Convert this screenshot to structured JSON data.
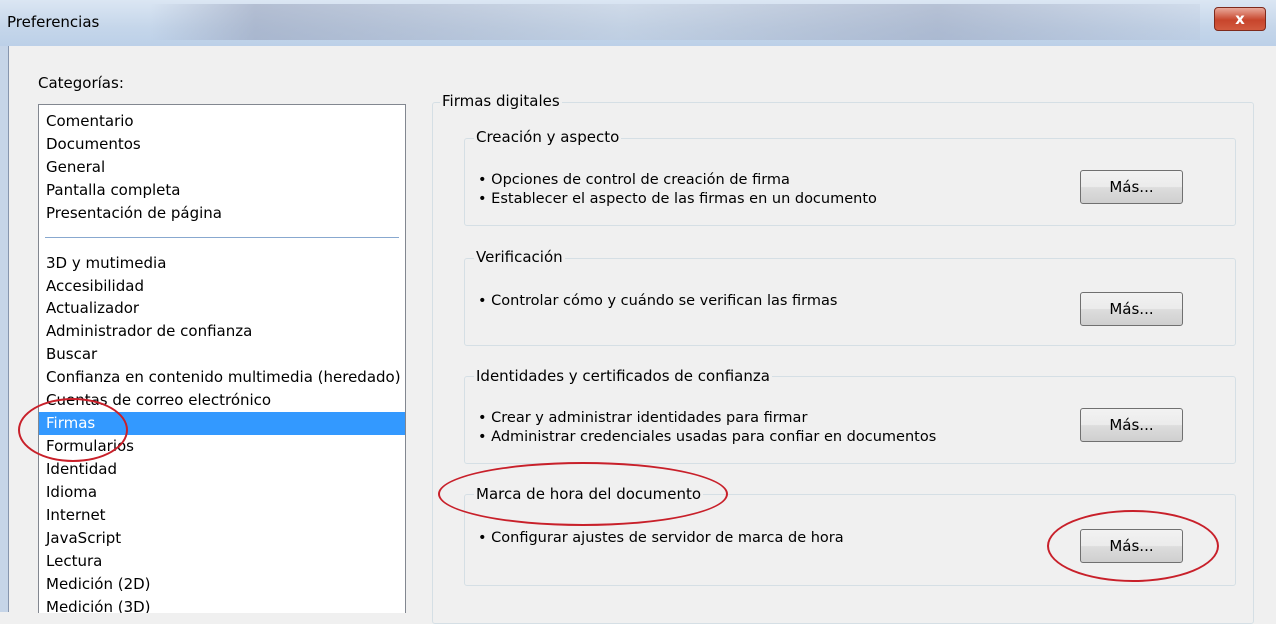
{
  "window": {
    "title": "Preferencias",
    "close_label": "x"
  },
  "categories_label": "Categorías:",
  "categories": {
    "group1": [
      "Comentario",
      "Documentos",
      "General",
      "Pantalla completa",
      "Presentación de página"
    ],
    "group2": [
      "3D y mutimedia",
      "Accesibilidad",
      "Actualizador",
      "Administrador de confianza",
      "Buscar",
      "Confianza en contenido multimedia (heredado)",
      "Cuentas de correo electrónico",
      "Firmas",
      "Formularios",
      "Identidad",
      "Idioma",
      "Internet",
      "JavaScript",
      "Lectura",
      "Medición (2D)",
      "Medición (3D)"
    ],
    "selected": "Firmas"
  },
  "panel": {
    "title": "Firmas digitales",
    "sections": [
      {
        "title": "Creación y aspecto",
        "lines": [
          "• Opciones de control de creación de firma",
          "• Establecer el aspecto de las firmas en un documento"
        ],
        "button": "Más..."
      },
      {
        "title": "Verificación",
        "lines": [
          "• Controlar cómo y cuándo se verifican las firmas"
        ],
        "button": "Más..."
      },
      {
        "title": "Identidades y certificados de confianza",
        "lines": [
          "• Crear y administrar identidades para firmar",
          "• Administrar credenciales usadas para confiar en documentos"
        ],
        "button": "Más..."
      },
      {
        "title": "Marca de hora del documento",
        "lines": [
          "• Configurar ajustes de servidor de marca de hora"
        ],
        "button": "Más..."
      }
    ]
  },
  "annotation_color": "#c8202a"
}
